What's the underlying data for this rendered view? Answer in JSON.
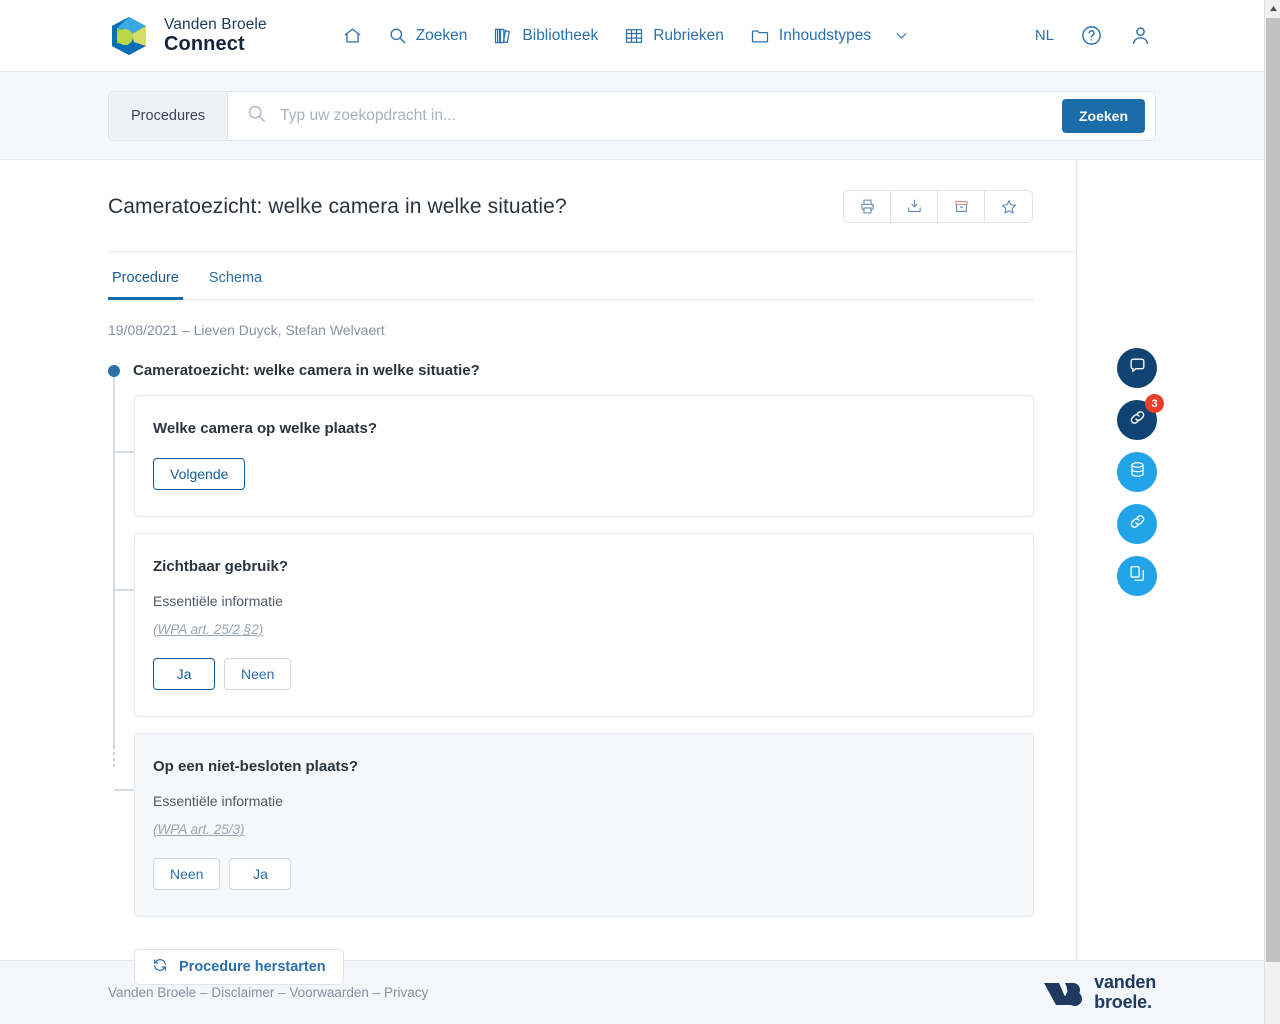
{
  "brand": {
    "line1": "Vanden Broele",
    "line2": "Connect",
    "logo_icon": "vb-polygon-logo"
  },
  "topnav": {
    "items": [
      {
        "label": "",
        "icon": "home-icon",
        "name": "home"
      },
      {
        "label": "Zoeken",
        "icon": "search-icon",
        "name": "zoeken"
      },
      {
        "label": "Bibliotheek",
        "icon": "books-icon",
        "name": "bibliotheek"
      },
      {
        "label": "Rubrieken",
        "icon": "grid-icon",
        "name": "rubrieken"
      },
      {
        "label": "Inhoudstypes",
        "icon": "folder-icon",
        "name": "inhoudstypes"
      }
    ],
    "chevron_icon": "chevron-down-icon",
    "language": "NL",
    "help_icon": "question-circle-icon",
    "account_icon": "user-icon"
  },
  "search": {
    "scope_label": "Procedures",
    "placeholder": "Typ uw zoekopdracht in...",
    "value": "",
    "submit_label": "Zoeken",
    "search_icon": "search-icon"
  },
  "document": {
    "title": "Cameratoezicht: welke camera in welke situatie?",
    "actions": [
      {
        "name": "print",
        "icon": "printer-icon"
      },
      {
        "name": "download",
        "icon": "download-icon"
      },
      {
        "name": "archive",
        "icon": "archive-box-icon"
      },
      {
        "name": "favorite",
        "icon": "star-icon"
      }
    ],
    "tabs": [
      {
        "label": "Procedure",
        "active": true
      },
      {
        "label": "Schema",
        "active": false
      }
    ],
    "meta": "19/08/2021 – Lieven Duyck, Stefan Welvaert"
  },
  "procedure": {
    "root_label": "Cameratoezicht: welke camera in welke situatie?",
    "steps": [
      {
        "question": "Welke camera op welke plaats?",
        "subtitle": "",
        "reference": "",
        "muted": false,
        "options": [
          {
            "label": "Volgende",
            "selected": true
          }
        ]
      },
      {
        "question": "Zichtbaar gebruik?",
        "subtitle": "Essentiële informatie",
        "reference": "(WPA art. 25/2 §2)",
        "muted": false,
        "options": [
          {
            "label": "Ja",
            "selected": true
          },
          {
            "label": "Neen",
            "selected": false
          }
        ]
      },
      {
        "question": "Op een niet-besloten plaats?",
        "subtitle": "Essentiële informatie",
        "reference": "(WPA art. 25/3)",
        "muted": true,
        "options": [
          {
            "label": "Neen",
            "selected": false
          },
          {
            "label": "Ja",
            "selected": false
          }
        ]
      }
    ],
    "restart_label": "Procedure herstarten",
    "restart_icon": "refresh-icon"
  },
  "right_rail": {
    "buttons": [
      {
        "name": "comments",
        "icon": "chat-bubble-icon",
        "style": "dark",
        "badge": ""
      },
      {
        "name": "links",
        "icon": "link-icon",
        "style": "dark",
        "badge": "3"
      },
      {
        "name": "database",
        "icon": "database-icon",
        "style": "light",
        "badge": ""
      },
      {
        "name": "related-links",
        "icon": "link-icon",
        "style": "light",
        "badge": ""
      },
      {
        "name": "documents",
        "icon": "copy-documents-icon",
        "style": "light",
        "badge": ""
      }
    ]
  },
  "footer": {
    "links": [
      "Vanden Broele",
      "Disclaimer",
      "Voorwaarden",
      "Privacy"
    ],
    "separator": " – ",
    "logo_line1": "vanden",
    "logo_line2": "broele.",
    "logo_icon": "vb-monogram-icon"
  },
  "colors": {
    "accent_blue": "#1a6ca8",
    "link_blue": "#2b70ab",
    "rail_dark": "#0f4372",
    "rail_light": "#23a3e8",
    "badge_red": "#e8402a",
    "navy": "#14243c"
  }
}
